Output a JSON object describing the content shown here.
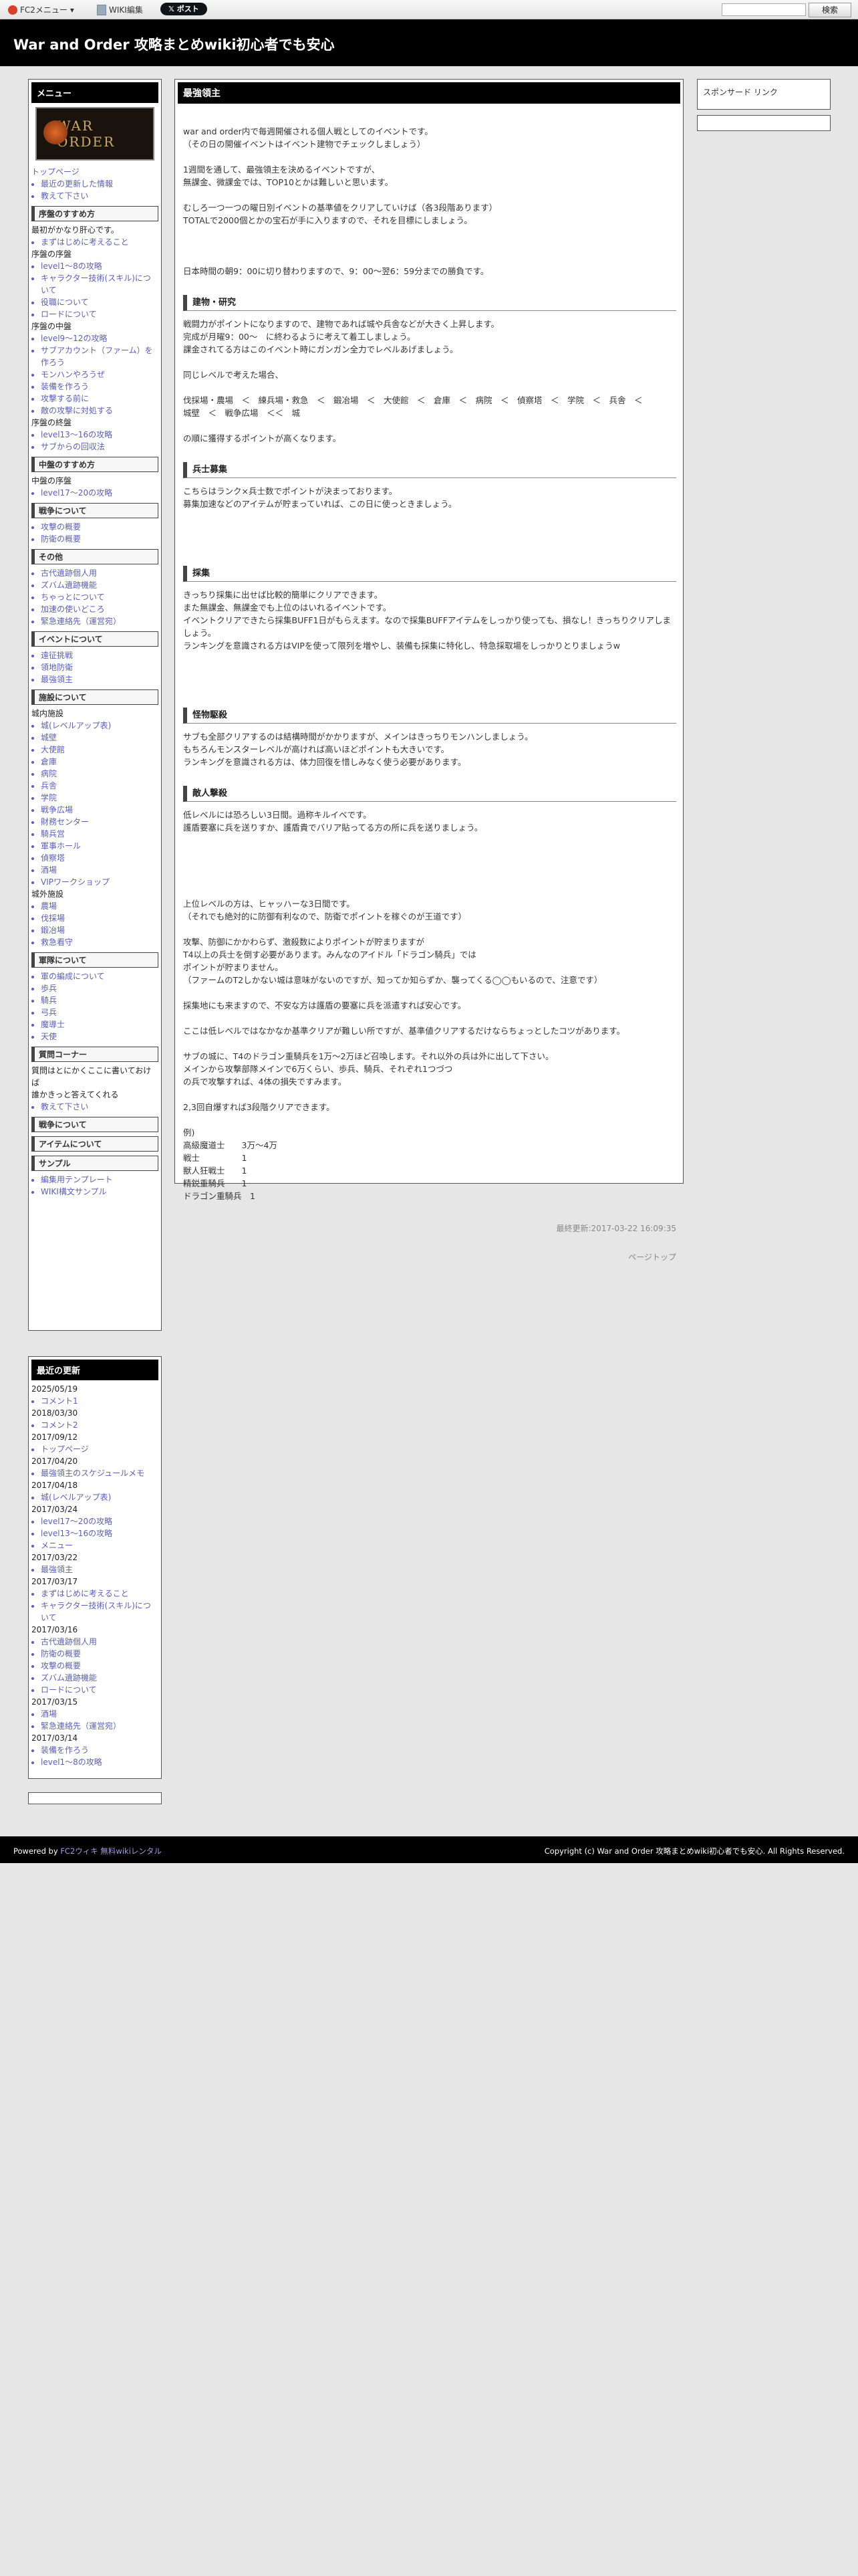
{
  "fc2bar": {
    "menu_label": "FC2メニュー",
    "wiki_edit": "WIKI編集",
    "post_button": "ポスト",
    "search_button": "検索"
  },
  "site": {
    "title": "War and Order 攻略まとめwiki初心者でも安心"
  },
  "menu": {
    "heading": "メニュー",
    "logo_text": "WAR ORDER",
    "top_links": [
      "トップページ"
    ],
    "top_list": [
      "最近の更新した情報",
      "教えて下さい"
    ],
    "sections": [
      {
        "title": "序盤のすすめ方",
        "lines": [
          {
            "type": "text",
            "text": "最初がかなり肝心です。"
          },
          {
            "type": "li",
            "text": "まずはじめに考えること"
          },
          {
            "type": "text",
            "text": "序盤の序盤"
          },
          {
            "type": "li",
            "text": "level1～8の攻略"
          },
          {
            "type": "li",
            "text": "キャラクター技術(スキル)について"
          },
          {
            "type": "li",
            "text": "役職について"
          },
          {
            "type": "li",
            "text": "ロードについて"
          },
          {
            "type": "text",
            "text": "序盤の中盤"
          },
          {
            "type": "li",
            "text": "level9～12の攻略"
          },
          {
            "type": "li",
            "text": "サブアカウント（ファーム）を作ろう"
          },
          {
            "type": "li",
            "text": "モンハンやろうぜ"
          },
          {
            "type": "li",
            "text": "装備を作ろう"
          },
          {
            "type": "li",
            "text": "攻撃する前に"
          },
          {
            "type": "li",
            "text": "敵の攻撃に対処する"
          },
          {
            "type": "text",
            "text": "序盤の終盤"
          },
          {
            "type": "li",
            "text": "level13～16の攻略"
          },
          {
            "type": "li",
            "text": "サブからの回収法"
          }
        ]
      },
      {
        "title": "中盤のすすめ方",
        "lines": [
          {
            "type": "text",
            "text": "中盤の序盤"
          },
          {
            "type": "li",
            "text": "level17～20の攻略"
          }
        ]
      },
      {
        "title": "戦争について",
        "lines": [
          {
            "type": "li",
            "text": "攻撃の概要"
          },
          {
            "type": "li",
            "text": "防衛の概要"
          }
        ]
      },
      {
        "title": "その他",
        "lines": [
          {
            "type": "li",
            "text": "古代遺跡個人用"
          },
          {
            "type": "li",
            "text": "ズバム遺跡機能"
          },
          {
            "type": "li",
            "text": "ちゃっとについて"
          },
          {
            "type": "li",
            "text": "加速の使いどころ"
          },
          {
            "type": "li",
            "text": "緊急連絡先（運営宛）"
          }
        ]
      },
      {
        "title": "イベントについて",
        "lines": [
          {
            "type": "li",
            "text": "遠征挑戦"
          },
          {
            "type": "li",
            "text": "領地防衛"
          },
          {
            "type": "li",
            "text": "最強領主"
          }
        ]
      },
      {
        "title": "施設について",
        "lines": [
          {
            "type": "text",
            "text": "城内施設"
          },
          {
            "type": "li",
            "text": "城(レベルアップ表)"
          },
          {
            "type": "li",
            "text": "城壁"
          },
          {
            "type": "li",
            "text": "大使館"
          },
          {
            "type": "li",
            "text": "倉庫"
          },
          {
            "type": "li",
            "text": "病院"
          },
          {
            "type": "li",
            "text": "兵舎"
          },
          {
            "type": "li",
            "text": "学院"
          },
          {
            "type": "li",
            "text": "戦争広場"
          },
          {
            "type": "li",
            "text": "財務センター"
          },
          {
            "type": "li",
            "text": "騎兵営"
          },
          {
            "type": "li",
            "text": "軍事ホール"
          },
          {
            "type": "li",
            "text": "偵察塔"
          },
          {
            "type": "li",
            "text": "酒場"
          },
          {
            "type": "li",
            "text": "VIPワークショップ"
          },
          {
            "type": "text",
            "text": "城外施設"
          },
          {
            "type": "li",
            "text": "農場"
          },
          {
            "type": "li",
            "text": "伐採場"
          },
          {
            "type": "li",
            "text": "鍛冶場"
          },
          {
            "type": "li",
            "text": "救急看守"
          }
        ]
      },
      {
        "title": "軍隊について",
        "lines": [
          {
            "type": "li",
            "text": "軍の編成について"
          },
          {
            "type": "li",
            "text": "歩兵"
          },
          {
            "type": "li",
            "text": "騎兵"
          },
          {
            "type": "li",
            "text": "弓兵"
          },
          {
            "type": "li",
            "text": "魔導士"
          },
          {
            "type": "li",
            "text": "天使"
          }
        ]
      },
      {
        "title": "質問コーナー",
        "lines": [
          {
            "type": "text",
            "text": "質問はとにかくここに書いておけば"
          },
          {
            "type": "text",
            "text": "誰かきっと答えてくれる"
          },
          {
            "type": "li",
            "text": "教えて下さい"
          }
        ]
      },
      {
        "title": "戦争について",
        "lines": []
      },
      {
        "title": "アイテムについて",
        "lines": []
      },
      {
        "title": "サンプル",
        "lines": [
          {
            "type": "li",
            "text": "編集用テンプレート"
          },
          {
            "type": "li",
            "text": "WIKI構文サンプル"
          }
        ]
      }
    ]
  },
  "recent": {
    "heading": "最近の更新",
    "groups": [
      {
        "date": "2025/05/19",
        "items": [
          "コメント1"
        ]
      },
      {
        "date": "2018/03/30",
        "items": [
          "コメント2"
        ]
      },
      {
        "date": "2017/09/12",
        "items": [
          "トップページ"
        ]
      },
      {
        "date": "2017/04/20",
        "items": [
          "最強領主のスケジュールメモ"
        ]
      },
      {
        "date": "2017/04/18",
        "items": [
          "城(レベルアップ表)"
        ]
      },
      {
        "date": "2017/03/24",
        "items": [
          "level17～20の攻略",
          "level13～16の攻略",
          "メニュー"
        ]
      },
      {
        "date": "2017/03/22",
        "items": [
          "最強領主"
        ]
      },
      {
        "date": "2017/03/17",
        "items": [
          "まずはじめに考えること",
          "キャラクター技術(スキル)について"
        ]
      },
      {
        "date": "2017/03/16",
        "items": [
          "古代遺跡個人用",
          "防衛の概要",
          "攻撃の概要",
          "ズバム遺跡機能",
          "ロードについて"
        ]
      },
      {
        "date": "2017/03/15",
        "items": [
          "酒場",
          "緊急連絡先（運営宛）"
        ]
      },
      {
        "date": "2017/03/14",
        "items": [
          "装備を作ろう",
          "level1～8の攻略"
        ]
      }
    ]
  },
  "main": {
    "heading": "最強領主",
    "blocks": [
      {
        "type": "p",
        "lines": [
          "war and order内で毎週開催される個人戦としてのイベントです。",
          "（その日の開催イベントはイベント建物でチェックしましょう）"
        ]
      },
      {
        "type": "p",
        "lines": [
          "1週間を通して、最強領主を決めるイベントですが、",
          "無課金、微課金では、TOP10とかは難しいと思います。"
        ]
      },
      {
        "type": "p",
        "lines": [
          "むしろ一つ一つの曜日別イベントの基準値をクリアしていけば（各3段階あります）",
          "TOTALで2000個とかの宝石が手に入りますので、それを目標にしましょう。"
        ]
      },
      {
        "type": "spacer"
      },
      {
        "type": "p",
        "lines": [
          "日本時間の朝9：00に切り替わりますので、9：00〜翌6：59分までの勝負です。"
        ]
      },
      {
        "type": "h3",
        "text": "建物・研究"
      },
      {
        "type": "p",
        "lines": [
          "戦闘力がポイントになりますので、建物であれば城や兵舎などが大きく上昇します。",
          "完成が月曜9：00〜　に終わるように考えて着工しましょう。",
          "課金されてる方はこのイベント時にガンガン全力でレベルあげましょう。"
        ]
      },
      {
        "type": "p",
        "lines": [
          "同じレベルで考えた場合、"
        ]
      },
      {
        "type": "p",
        "lines": [
          "伐採場・農場　＜　練兵場・救急　＜　鍛冶場　＜　大使館　＜　倉庫　＜　病院　＜　偵察塔　＜　学院　＜　兵舎　＜",
          "城壁　＜　戦争広場　＜＜　城"
        ]
      },
      {
        "type": "p",
        "lines": [
          "の順に獲得するポイントが高くなります。"
        ]
      },
      {
        "type": "h3",
        "text": "兵士募集"
      },
      {
        "type": "p",
        "lines": [
          "こちらはランク×兵士数でポイントが決まっております。",
          "募集加速などのアイテムが貯まっていれば、この日に使っときましょう。"
        ]
      },
      {
        "type": "spacer"
      },
      {
        "type": "h3",
        "text": "採集"
      },
      {
        "type": "p",
        "lines": [
          "きっちり採集に出せば比較的簡単にクリアできます。",
          "また無課金、無課金でも上位のはいれるイベントです。",
          "イベントクリアできたら採集BUFF1日がもらえます。なので採集BUFFアイテムをしっかり使っても、損なし！きっちりクリアしましょう。",
          "ランキングを意識される方はVIPを使って限列を増やし、装備も採集に特化し、特急採取場をしっかりとりましょうw"
        ]
      },
      {
        "type": "spacer"
      },
      {
        "type": "h3",
        "text": "怪物駆殺"
      },
      {
        "type": "p",
        "lines": [
          "サブも全部クリアするのは結構時間がかかりますが、メインはきっちりモンハンしましょう。",
          "もちろんモンスターレベルが高ければ高いほどポイントも大きいです。",
          "ランキングを意識される方は、体力回復を惜しみなく使う必要があります。"
        ]
      },
      {
        "type": "h3",
        "text": "敵人撃殺"
      },
      {
        "type": "p",
        "lines": [
          "低レベルには恐ろしい3日間。過称キルイベです。",
          "護盾要塞に兵を送りすか、護盾貴でバリア貼ってる方の所に兵を送りましょう。"
        ]
      },
      {
        "type": "spacer"
      },
      {
        "type": "spacer"
      },
      {
        "type": "p",
        "lines": [
          "上位レベルの方は、ヒャッハーな3日間です。",
          "（それでも絶対的に防御有利なので、防衛でポイントを稼ぐのが王道です）"
        ]
      },
      {
        "type": "p",
        "lines": [
          "攻撃、防御にかかわらず、激殺数によりポイントが貯まりますが",
          "T4以上の兵士を倒す必要があります。みんなのアイドル「ドラゴン騎兵」では",
          "ポイントが貯まりません。",
          "（ファームのT2しかない城は意味がないのですが、知ってか知らずか、襲ってくる◯◯もいるので、注意です）"
        ]
      },
      {
        "type": "p",
        "lines": [
          "採集地にも来ますので、不安な方は護盾の要塞に兵を派遣すれば安心です。"
        ]
      },
      {
        "type": "p",
        "lines": [
          "ここは低レベルではなかなか基準クリアが難しい所ですが、基準値クリアするだけならちょっとしたコツがあります。"
        ]
      },
      {
        "type": "p",
        "lines": [
          "サブの城に、T4のドラゴン重騎兵を1万〜2万ほど召喚します。それ以外の兵は外に出して下さい。",
          "メインから攻撃部隊メインで6万くらい、歩兵、騎兵、それぞれ1つづつ",
          "の兵で攻撃すれば、4体の損失ですみます。"
        ]
      },
      {
        "type": "p",
        "lines": [
          "2,3回自爆すれば3段階クリアできます。"
        ]
      },
      {
        "type": "p",
        "lines": [
          "例)",
          "高級魔道士　　3万〜4万",
          "戦士　　　　　1",
          "獣人狂戦士　　1",
          "精鋭重騎兵　　1",
          "ドラゴン重騎兵　1"
        ]
      }
    ],
    "updated": "最終更新:2017-03-22 16:09:35",
    "page_top": "ページトップ"
  },
  "sponsor": {
    "label": "スポンサード リンク"
  },
  "footer": {
    "powered_prefix": "Powered by ",
    "powered_link": "FC2ウィキ 無料wikiレンタル",
    "copyright": "Copyright (c) War and Order 攻略まとめwiki初心者でも安心. All Rights Reserved."
  }
}
